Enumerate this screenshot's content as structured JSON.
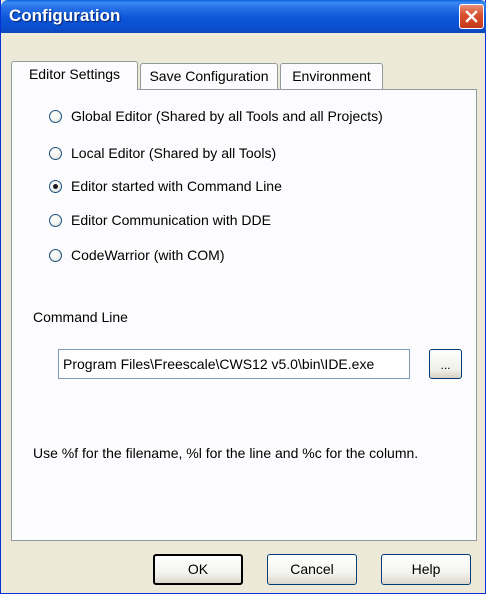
{
  "window": {
    "title": "Configuration"
  },
  "tabs": [
    {
      "label": "Editor Settings",
      "active": true
    },
    {
      "label": "Save Configuration",
      "active": false
    },
    {
      "label": "Environment",
      "active": false
    }
  ],
  "editor_options": [
    {
      "label": "Global Editor (Shared by all Tools and all Projects)",
      "checked": false
    },
    {
      "label": "Local Editor (Shared by all Tools)",
      "checked": false
    },
    {
      "label": "Editor started with Command Line",
      "checked": true
    },
    {
      "label": "Editor Communication with DDE",
      "checked": false
    },
    {
      "label": "CodeWarrior (with COM)",
      "checked": false
    }
  ],
  "command_line": {
    "label": "Command Line",
    "value": "Program Files\\Freescale\\CWS12 v5.0\\bin\\IDE.exe",
    "browse_label": "..."
  },
  "hint": "Use %f for the filename, %l for the line and %c for the column.",
  "buttons": {
    "ok": "OK",
    "cancel": "Cancel",
    "help": "Help"
  }
}
